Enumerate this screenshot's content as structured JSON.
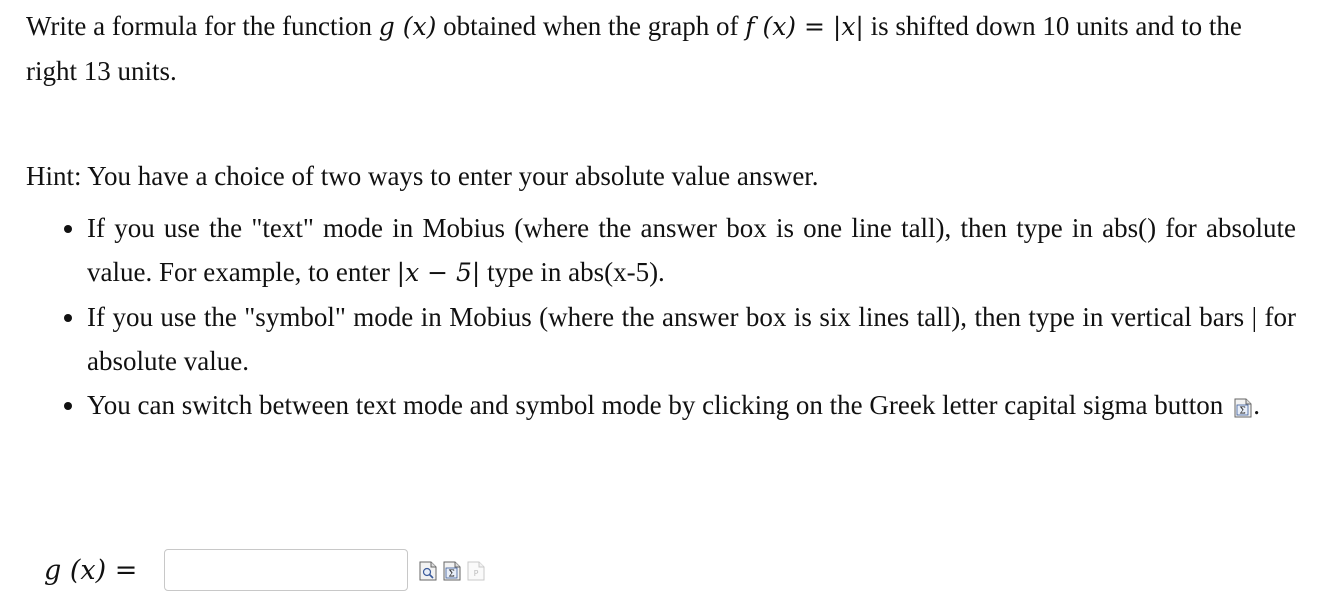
{
  "question": {
    "part1": "Write a formula for the function ",
    "g_of_x": "g (x)",
    "part2": " obtained when the graph of ",
    "f_of_x": "f (x) = |x|",
    "part3": " is shifted down 10 units and to the right 13 units."
  },
  "hint": {
    "intro": "Hint: You have a choice of two ways to enter your absolute value answer.",
    "bullet1_a": "If you use the \"text\" mode in Mobius (where the answer box is one line tall), then type in abs() for absolute value. For example, to enter ",
    "bullet1_math": "|x − 5|",
    "bullet1_b": " type in abs(x-5).",
    "bullet2": "If you use the \"symbol\" mode in Mobius (where the answer box is six lines tall), then type in vertical bars | for absolute value.",
    "bullet3_a": "You can switch between text mode and symbol mode by clicking on the Greek letter capital sigma button",
    "bullet3_b": "."
  },
  "answer": {
    "label": "g (x) =",
    "value": "",
    "placeholder": ""
  },
  "icons": {
    "preview": "preview-icon",
    "sigma": "sigma-icon",
    "plot": "plot-icon"
  }
}
